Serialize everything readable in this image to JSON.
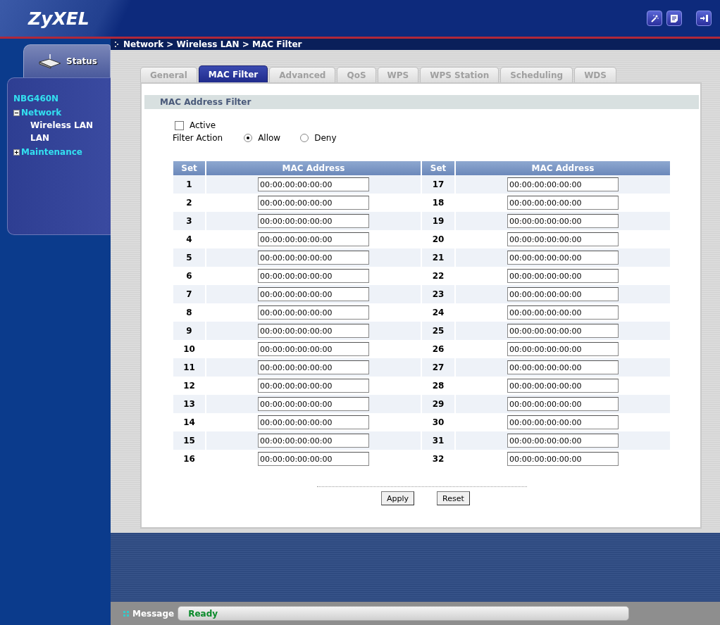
{
  "header": {
    "logo": "ZyXEL"
  },
  "breadcrumb": "Network > Wireless LAN > MAC Filter",
  "sidebar": {
    "status_tab": "Status",
    "device": "NBG460N",
    "tree": [
      {
        "label": "Network",
        "expanded": true,
        "children": [
          {
            "label": "Wireless LAN"
          },
          {
            "label": "LAN"
          }
        ]
      },
      {
        "label": "Maintenance",
        "expanded": false
      }
    ]
  },
  "tabs": [
    {
      "label": "General",
      "selected": false
    },
    {
      "label": "MAC Filter",
      "selected": true
    },
    {
      "label": "Advanced",
      "selected": false
    },
    {
      "label": "QoS",
      "selected": false
    },
    {
      "label": "WPS",
      "selected": false
    },
    {
      "label": "WPS Station",
      "selected": false
    },
    {
      "label": "Scheduling",
      "selected": false
    },
    {
      "label": "WDS",
      "selected": false
    }
  ],
  "section_title": "MAC Address Filter",
  "active": {
    "label": "Active",
    "checked": false
  },
  "filter_action": {
    "label": "Filter Action",
    "options": [
      {
        "label": "Allow",
        "selected": true
      },
      {
        "label": "Deny",
        "selected": false
      }
    ]
  },
  "table": {
    "columns": [
      "Set",
      "MAC Address",
      "Set",
      "MAC Address"
    ],
    "rows": [
      {
        "set_1": "1",
        "mac_1": "00:00:00:00:00:00",
        "set_2": "17",
        "mac_2": "00:00:00:00:00:00"
      },
      {
        "set_1": "2",
        "mac_1": "00:00:00:00:00:00",
        "set_2": "18",
        "mac_2": "00:00:00:00:00:00"
      },
      {
        "set_1": "3",
        "mac_1": "00:00:00:00:00:00",
        "set_2": "19",
        "mac_2": "00:00:00:00:00:00"
      },
      {
        "set_1": "4",
        "mac_1": "00:00:00:00:00:00",
        "set_2": "20",
        "mac_2": "00:00:00:00:00:00"
      },
      {
        "set_1": "5",
        "mac_1": "00:00:00:00:00:00",
        "set_2": "21",
        "mac_2": "00:00:00:00:00:00"
      },
      {
        "set_1": "6",
        "mac_1": "00:00:00:00:00:00",
        "set_2": "22",
        "mac_2": "00:00:00:00:00:00"
      },
      {
        "set_1": "7",
        "mac_1": "00:00:00:00:00:00",
        "set_2": "23",
        "mac_2": "00:00:00:00:00:00"
      },
      {
        "set_1": "8",
        "mac_1": "00:00:00:00:00:00",
        "set_2": "24",
        "mac_2": "00:00:00:00:00:00"
      },
      {
        "set_1": "9",
        "mac_1": "00:00:00:00:00:00",
        "set_2": "25",
        "mac_2": "00:00:00:00:00:00"
      },
      {
        "set_1": "10",
        "mac_1": "00:00:00:00:00:00",
        "set_2": "26",
        "mac_2": "00:00:00:00:00:00"
      },
      {
        "set_1": "11",
        "mac_1": "00:00:00:00:00:00",
        "set_2": "27",
        "mac_2": "00:00:00:00:00:00"
      },
      {
        "set_1": "12",
        "mac_1": "00:00:00:00:00:00",
        "set_2": "28",
        "mac_2": "00:00:00:00:00:00"
      },
      {
        "set_1": "13",
        "mac_1": "00:00:00:00:00:00",
        "set_2": "29",
        "mac_2": "00:00:00:00:00:00"
      },
      {
        "set_1": "14",
        "mac_1": "00:00:00:00:00:00",
        "set_2": "30",
        "mac_2": "00:00:00:00:00:00"
      },
      {
        "set_1": "15",
        "mac_1": "00:00:00:00:00:00",
        "set_2": "31",
        "mac_2": "00:00:00:00:00:00"
      },
      {
        "set_1": "16",
        "mac_1": "00:00:00:00:00:00",
        "set_2": "32",
        "mac_2": "00:00:00:00:00:00"
      }
    ]
  },
  "buttons": [
    "Apply",
    "Reset"
  ],
  "status_bar": {
    "label": "Message",
    "message": "Ready"
  }
}
